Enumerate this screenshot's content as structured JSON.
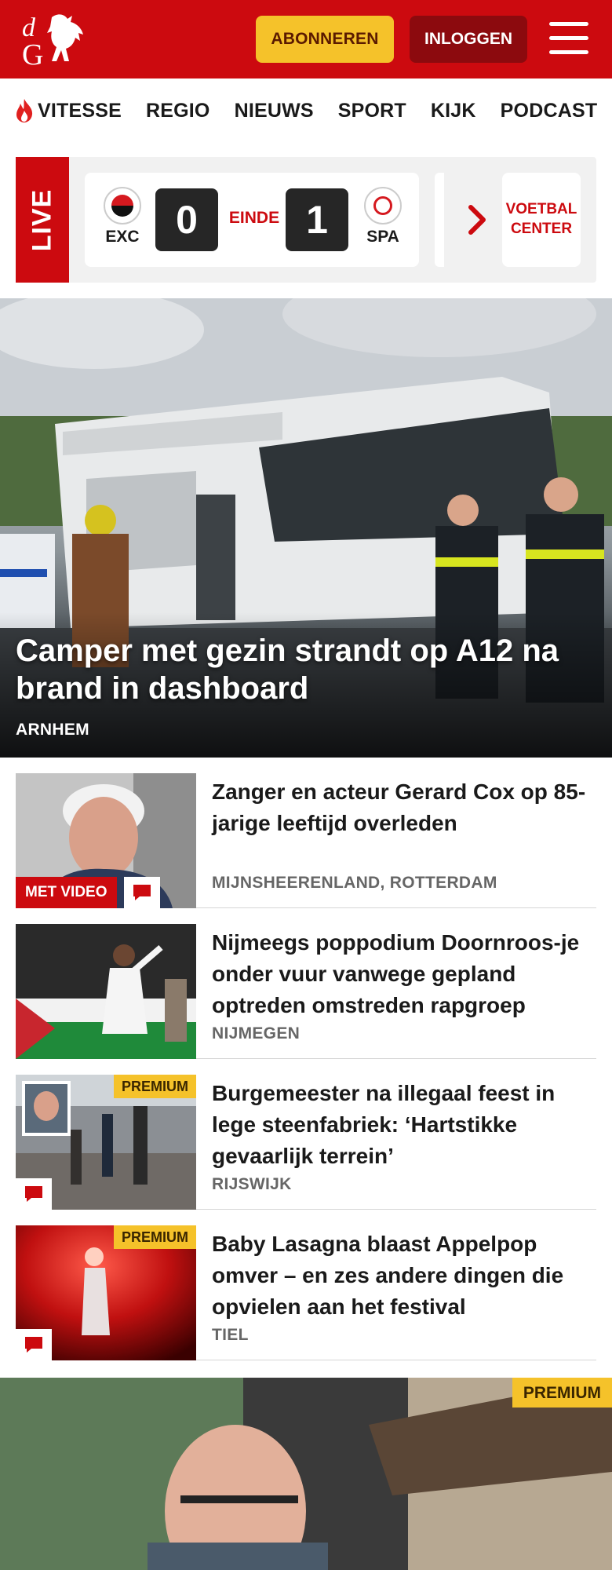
{
  "header": {
    "subscribe_label": "ABONNEREN",
    "login_label": "INLOGGEN",
    "brand_color": "#cc0a0f",
    "accent_color": "#f5c22a"
  },
  "nav": {
    "items": [
      {
        "label": "VITESSE",
        "icon": "flame-icon"
      },
      {
        "label": "REGIO"
      },
      {
        "label": "NIEUWS"
      },
      {
        "label": "SPORT"
      },
      {
        "label": "KIJK"
      },
      {
        "label": "PODCAST"
      }
    ]
  },
  "live": {
    "tag": "LIVE",
    "match": {
      "home": {
        "abbr": "EXC",
        "score": "0"
      },
      "status": "EINDE",
      "away": {
        "abbr": "SPA",
        "score": "1"
      }
    },
    "voetbal_center": "VOETBAL CENTER"
  },
  "hero": {
    "title": "Camper met gezin strandt op A12 na brand in dashboard",
    "location": "ARNHEM"
  },
  "articles": [
    {
      "title": "Zanger en acteur Gerard Cox op 85-jarige leeftijd overleden",
      "location": "MIJNSHEERENLAND, ROTTERDAM",
      "video_badge": "MET VIDEO"
    },
    {
      "title": "Nijmeegs poppodium Doornroos-je onder vuur vanwege gepland optreden omstreden rapgroep",
      "location": "NIJMEGEN"
    },
    {
      "title": "Burgemeester na illegaal feest in lege steenfabriek: ‘Hartstikke gevaarlijk terrein’",
      "location": "RIJSWIJK",
      "premium_badge": "PREMIUM"
    },
    {
      "title": "Baby Lasagna blaast Appelpop omver – en zes andere dingen die opvielen aan het festival",
      "location": "TIEL",
      "premium_badge": "PREMIUM"
    }
  ],
  "bottom_feature": {
    "premium_badge": "PREMIUM"
  }
}
